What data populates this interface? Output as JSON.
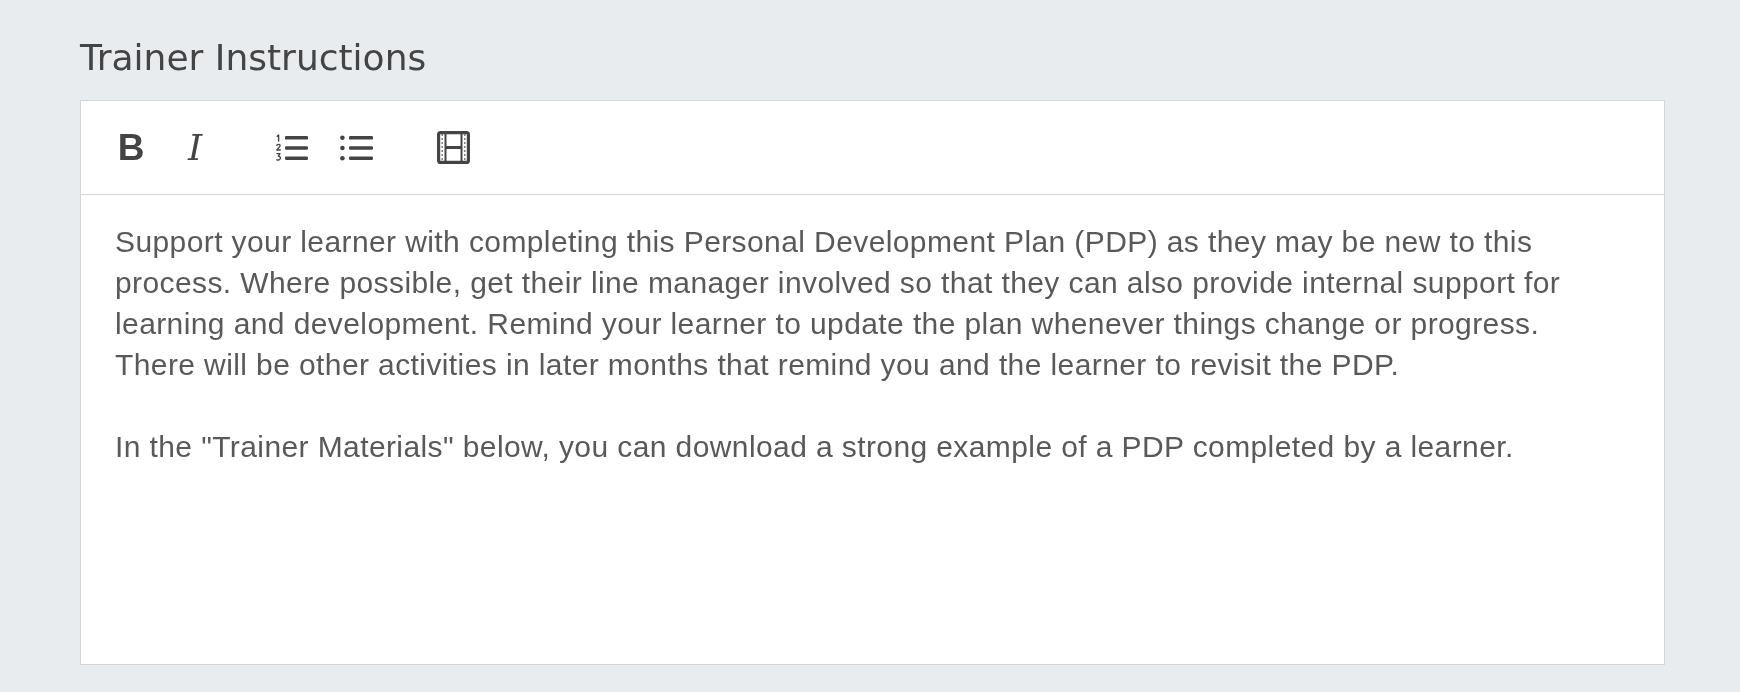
{
  "title": "Trainer Instructions",
  "editor": {
    "toolbar": [
      {
        "buttons": [
          {
            "kind": "bold",
            "label": "B"
          },
          {
            "kind": "italic",
            "label": "I"
          }
        ]
      },
      {
        "buttons": [
          {
            "kind": "ordered-list"
          },
          {
            "kind": "bullet-list"
          }
        ]
      },
      {
        "buttons": [
          {
            "kind": "media"
          }
        ]
      }
    ],
    "paragraphs": [
      "Support your learner with completing this Personal Development Plan (PDP) as they may be new to this process. Where possible, get their line manager involved so that they can also provide internal support for learning and development. Remind your learner to update the plan whenever things change or progress. There will be other activities in later months that remind you and the learner to revisit the PDP.",
      "In the \"Trainer Materials\" below, you can download a strong example of a PDP completed by a learner."
    ]
  }
}
